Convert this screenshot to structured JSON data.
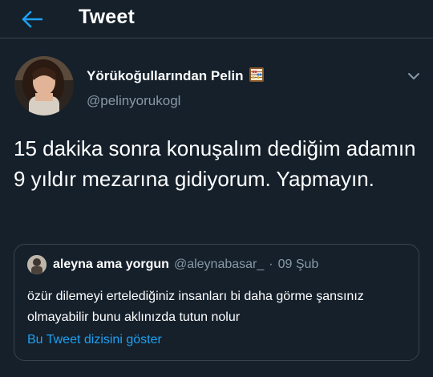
{
  "header": {
    "title": "Tweet",
    "back_icon": "arrow-left-icon"
  },
  "tweet": {
    "display_name": "Yörükoğullarından Pelin",
    "emoji_icon": "abacus-icon",
    "handle": "@pelinyorukogl",
    "text": "15 dakika sonra konuşalım dediğim adamın 9 yıldır mezarına gidiyorum. Yapmayın.",
    "menu_icon": "chevron-down-icon"
  },
  "quote": {
    "name": "aleyna ama yorgun",
    "handle": "@aleynabasar_",
    "separator": "·",
    "date": "09 Şub",
    "text": "özür dilemeyi ertelediğiniz insanları bi daha görme şansınız olmayabilir bunu aklınızda tutun nolur",
    "show_thread": "Bu Tweet dizisini göster"
  },
  "colors": {
    "background": "#15202b",
    "accent": "#1da1f2",
    "secondary_text": "#8899a6",
    "border": "#38444d"
  }
}
